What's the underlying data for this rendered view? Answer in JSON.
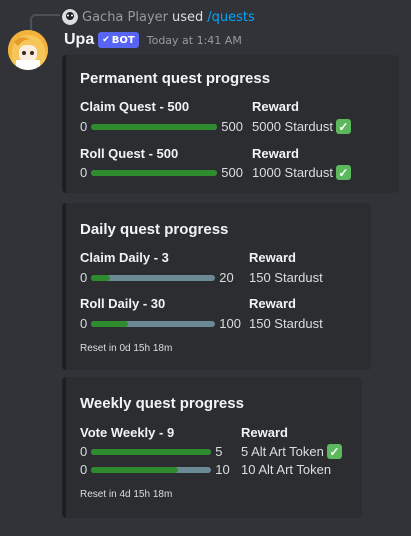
{
  "reply": {
    "user": "Gacha Player",
    "used_text": "used",
    "command": "/quests"
  },
  "message": {
    "username": "Upa",
    "bot_tag": "BOT",
    "timestamp": "Today at 1:41 AM"
  },
  "embeds": [
    {
      "title": "Permanent quest progress",
      "quests": [
        {
          "name": "Claim Quest - 500",
          "start": "0",
          "end": "500",
          "progress": 1.0,
          "reward_header": "Reward",
          "reward": "5000 Stardust",
          "completed": true
        },
        {
          "name": "Roll Quest - 500",
          "start": "0",
          "end": "500",
          "progress": 1.0,
          "reward_header": "Reward",
          "reward": "1000 Stardust",
          "completed": true
        }
      ]
    },
    {
      "title": "Daily quest progress",
      "quests": [
        {
          "name": "Claim Daily - 3",
          "start": "0",
          "end": "20",
          "progress": 0.15,
          "reward_header": "Reward",
          "reward": "150 Stardust",
          "completed": false
        },
        {
          "name": "Roll Daily - 30",
          "start": "0",
          "end": "100",
          "progress": 0.3,
          "reward_header": "Reward",
          "reward": "150 Stardust",
          "completed": false
        }
      ],
      "footer": "Reset in 0d 15h 18m"
    },
    {
      "title": "Weekly quest progress",
      "quest_name": "Vote Weekly - 9",
      "reward_header": "Reward",
      "tiers": [
        {
          "start": "0",
          "end": "5",
          "progress": 1.0,
          "reward": "5 Alt Art Token",
          "completed": true
        },
        {
          "start": "0",
          "end": "10",
          "progress": 0.72,
          "reward": "10 Alt Art Token",
          "completed": false
        }
      ],
      "footer": "Reset in 4d 15h 18m"
    }
  ],
  "colors": {
    "background": "#313338",
    "embed": "#2b2d31",
    "bar_track": "#6c8a96",
    "bar_fill": "#2e8b2e",
    "check": "#5cb85c",
    "bot_tag": "#5865f2",
    "command": "#00a8fc"
  }
}
